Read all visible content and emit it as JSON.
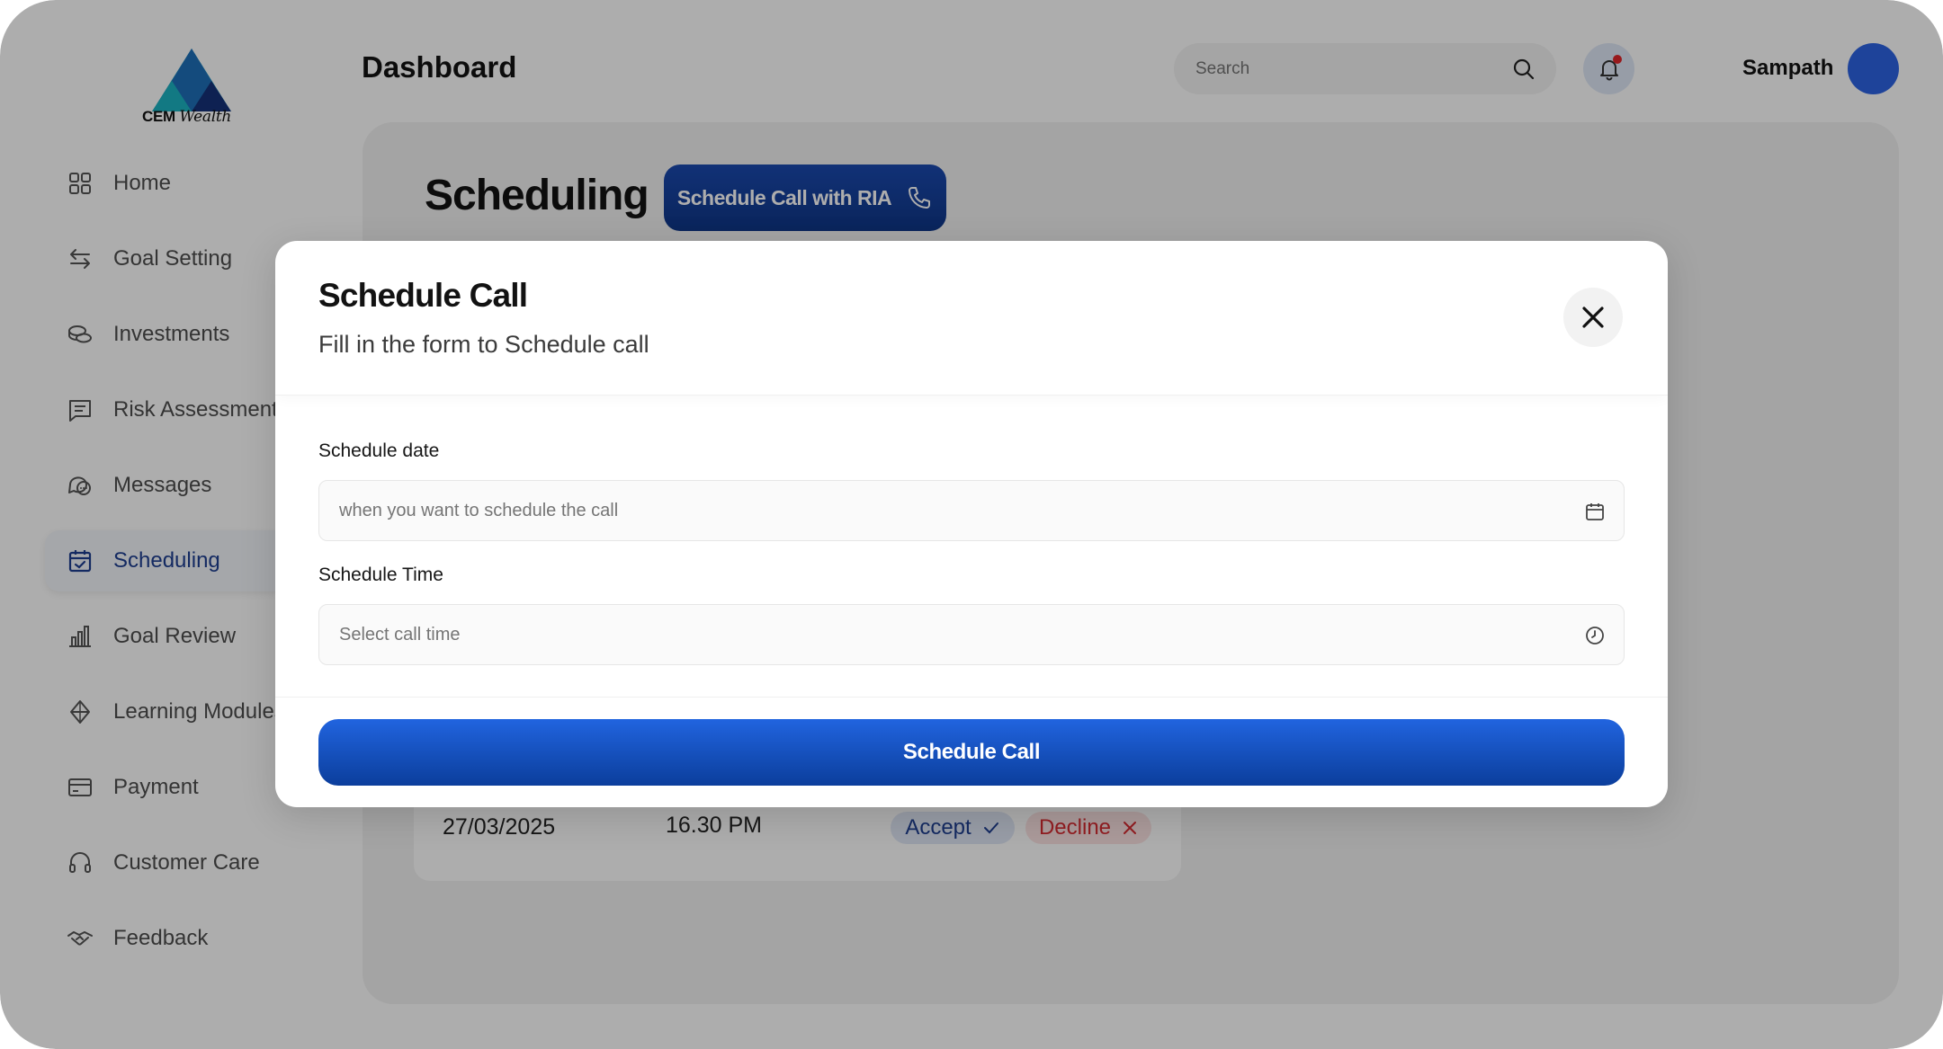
{
  "brand": {
    "name_bold": "CEM",
    "name_script": "Wealth"
  },
  "header": {
    "title": "Dashboard",
    "search_placeholder": "Search",
    "user_name": "Sampath"
  },
  "sidebar": {
    "items": [
      {
        "label": "Home",
        "icon": "grid-icon"
      },
      {
        "label": "Goal Setting",
        "icon": "arrows-swap-icon"
      },
      {
        "label": "Investments",
        "icon": "coins-icon"
      },
      {
        "label": "Risk Assessment",
        "icon": "message-lines-icon"
      },
      {
        "label": "Messages",
        "icon": "chat-bubbles-icon"
      },
      {
        "label": "Scheduling",
        "icon": "calendar-check-icon",
        "active": true
      },
      {
        "label": "Goal Review",
        "icon": "bar-chart-icon"
      },
      {
        "label": "Learning Modules",
        "icon": "diamond-icon"
      },
      {
        "label": "Payment",
        "icon": "card-icon"
      },
      {
        "label": "Customer Care",
        "icon": "headset-icon"
      },
      {
        "label": "Feedback",
        "icon": "handshake-icon"
      }
    ]
  },
  "scheduling": {
    "title": "Scheduling",
    "ria_button": "Schedule Call with RIA",
    "row": {
      "date": "27/03/2025",
      "time": "16.30 PM",
      "accept": "Accept",
      "decline": "Decline"
    }
  },
  "modal": {
    "title": "Schedule Call",
    "subtitle": "Fill in the form to Schedule call",
    "date_label": "Schedule date",
    "date_placeholder": "when you want to schedule the call",
    "time_label": "Schedule Time",
    "time_placeholder": "Select call time",
    "submit": "Schedule Call"
  },
  "colors": {
    "accent": "#1E3F91",
    "primary_button": "#1B4AB0",
    "accept_text": "#1E3F91",
    "decline_text": "#D72B32",
    "notification_dot": "#E0252A",
    "avatar": "#2D64E4"
  }
}
